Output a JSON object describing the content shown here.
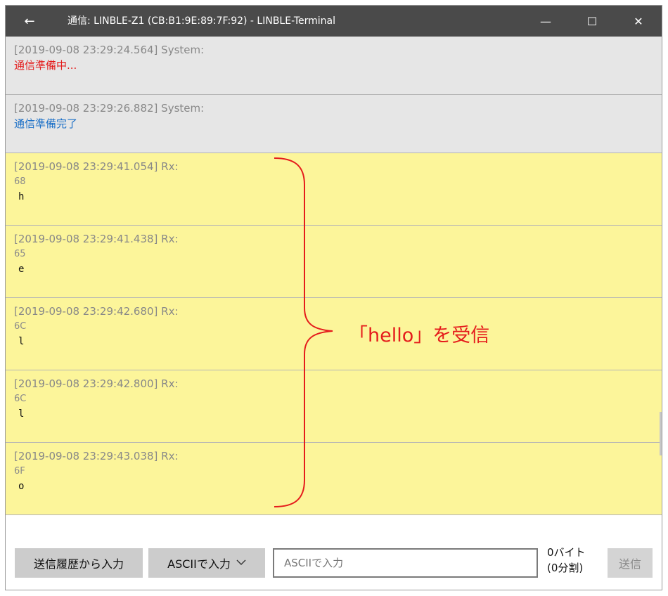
{
  "window": {
    "title": "通信: LINBLE-Z1 (CB:B1:9E:89:7F:92) - LINBLE-Terminal",
    "back_icon": "←",
    "min_icon": "—",
    "max_icon": "☐",
    "close_icon": "✕"
  },
  "messages": [
    {
      "header": "[2019-09-08 23:29:24.564]  System:",
      "body": "通信準備中..."
    },
    {
      "header": "[2019-09-08 23:29:26.882]  System:",
      "body": "通信準備完了"
    },
    {
      "header": "[2019-09-08 23:29:41.054]  Rx:",
      "hex": "68",
      "char": "h"
    },
    {
      "header": "[2019-09-08 23:29:41.438]  Rx:",
      "hex": "65",
      "char": "e"
    },
    {
      "header": "[2019-09-08 23:29:42.680]  Rx:",
      "hex": "6C",
      "char": "l"
    },
    {
      "header": "[2019-09-08 23:29:42.800]  Rx:",
      "hex": "6C",
      "char": "l"
    },
    {
      "header": "[2019-09-08 23:29:43.038]  Rx:",
      "hex": "6F",
      "char": "o"
    }
  ],
  "annotation": {
    "text": "「hello」を受信",
    "color": "#e51c1c"
  },
  "controls": {
    "history_button": "送信履歴から入力",
    "mode_button": "ASCIIで入力",
    "input_placeholder": "ASCIIで入力",
    "byte_count": "0バイト",
    "split_count": "(0分割)",
    "send_button": "送信"
  },
  "colors": {
    "titlebar": "#4a4a4a",
    "system_bg": "#e6e6e6",
    "rx_bg": "#fcf59a",
    "status_red": "#e31b1b",
    "status_blue": "#1a6fc7"
  }
}
